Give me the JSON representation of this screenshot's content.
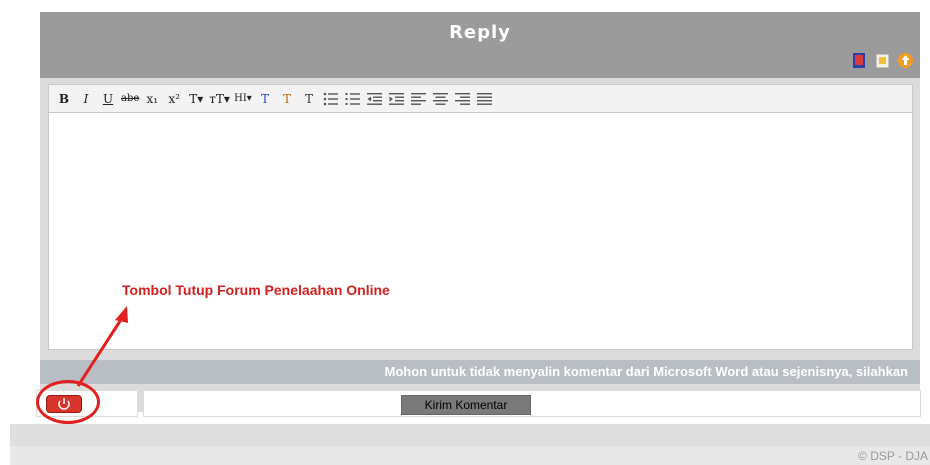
{
  "reply": {
    "title": "Reply",
    "icons": [
      "book-icon",
      "clipboard-icon",
      "upload-icon"
    ]
  },
  "toolbar": {
    "buttons": [
      {
        "name": "bold-button",
        "label": "B"
      },
      {
        "name": "italic-button",
        "label": "I"
      },
      {
        "name": "underline-button",
        "label": "U"
      },
      {
        "name": "strikethrough-button",
        "label": "abe"
      },
      {
        "name": "subscript-button",
        "label": "x₁"
      },
      {
        "name": "superscript-button",
        "label": "x²"
      },
      {
        "name": "font-family-button",
        "label": "T▾"
      },
      {
        "name": "font-size-button",
        "label": "тT▾"
      },
      {
        "name": "heading-button",
        "label": "HI▾"
      },
      {
        "name": "font-color-button",
        "label": "T"
      },
      {
        "name": "highlight-button",
        "label": "T"
      },
      {
        "name": "clear-format-button",
        "label": "T"
      }
    ],
    "list_icons": [
      "unordered-list-icon",
      "ordered-list-icon",
      "outdent-icon",
      "indent-icon",
      "align-left-icon",
      "align-center-icon",
      "align-right-icon",
      "justify-icon"
    ]
  },
  "annotation": "Tombol Tutup Forum Penelaahan Online",
  "notice": "Mohon untuk tidak menyalin komentar dari Microsoft Word atau sejenisnya, silahkan",
  "submit_label": "Kirim Komentar",
  "copyright": "© DSP - DJA",
  "colors": {
    "header": "#9b9b9b",
    "annotation_red": "#d51f1f",
    "power_button": "#d9342b"
  }
}
